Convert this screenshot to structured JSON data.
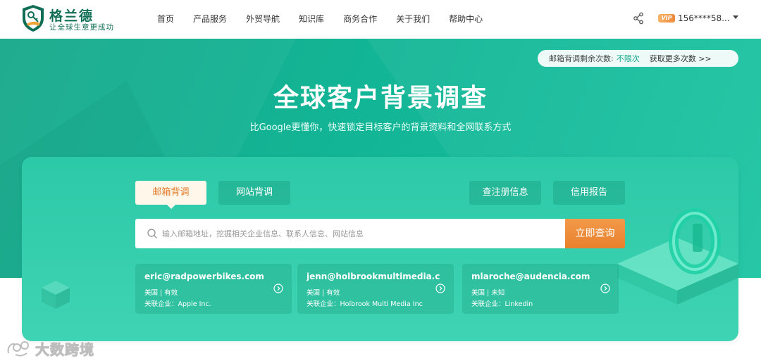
{
  "brand": {
    "name": "格兰德",
    "slogan": "让全球生意更成功"
  },
  "nav": {
    "items": [
      {
        "label": "首页"
      },
      {
        "label": "产品服务"
      },
      {
        "label": "外贸导航"
      },
      {
        "label": "知识库"
      },
      {
        "label": "商务合作"
      },
      {
        "label": "关于我们"
      },
      {
        "label": "帮助中心"
      }
    ]
  },
  "user": {
    "vip_label": "VIP",
    "phone": "156****58..."
  },
  "quota": {
    "label": "邮箱背调剩余次数:",
    "value": "不限次",
    "more": "获取更多次数 >>"
  },
  "hero": {
    "title": "全球客户背景调查",
    "subtitle": "比Google更懂你，快速锁定目标客户的背景资料和全网联系方式"
  },
  "tabs": {
    "email": "邮箱背调",
    "site": "网站背调",
    "registration": "查注册信息",
    "credit": "信用报告"
  },
  "search": {
    "placeholder": "输入邮箱地址，挖掘相关企业信息、联系人信息、网站信息",
    "value": "",
    "button": "立即查询"
  },
  "results": [
    {
      "email": "eric@radpowerbikes.com",
      "meta": "美国 | 有效",
      "company": "关联企业：Apple Inc."
    },
    {
      "email": "jenn@holbrookmultimedia.c...",
      "meta": "美国 | 有效",
      "company": "关联企业：Holbrook Multi Media Inc"
    },
    {
      "email": "mlaroche@audencia.com",
      "meta": "美国 | 未知",
      "company": "关联企业：Linkedin"
    }
  ],
  "watermark": {
    "text": "大数跨境"
  },
  "colors": {
    "brand_green": "#0f6e55",
    "hero_teal": "#12b596",
    "accent_orange": "#e8802c"
  }
}
